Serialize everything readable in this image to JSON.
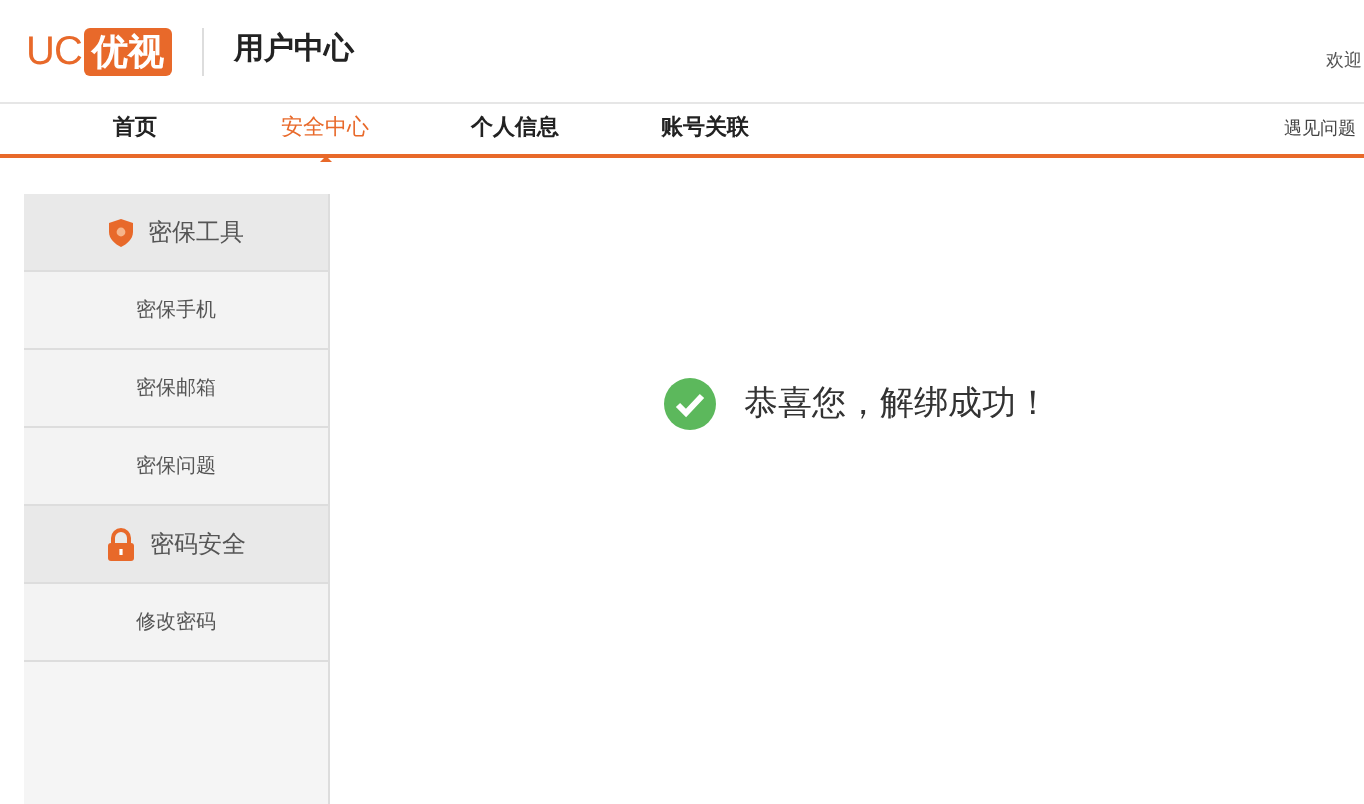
{
  "header": {
    "logo_left": "UC",
    "logo_right": "优视",
    "title": "用户中心",
    "welcome": "欢迎"
  },
  "nav": {
    "tabs": [
      {
        "label": "首页",
        "selected": false
      },
      {
        "label": "安全中心",
        "selected": true
      },
      {
        "label": "个人信息",
        "selected": false
      },
      {
        "label": "账号关联",
        "selected": false
      }
    ],
    "help": "遇见问题"
  },
  "sidebar": {
    "groups": [
      {
        "title": "密保工具",
        "kind": "shield",
        "items": [
          "密保手机",
          "密保邮箱",
          "密保问题"
        ]
      },
      {
        "title": "密码安全",
        "kind": "lock",
        "items": [
          "修改密码"
        ]
      }
    ]
  },
  "message": "恭喜您，解绑成功！"
}
